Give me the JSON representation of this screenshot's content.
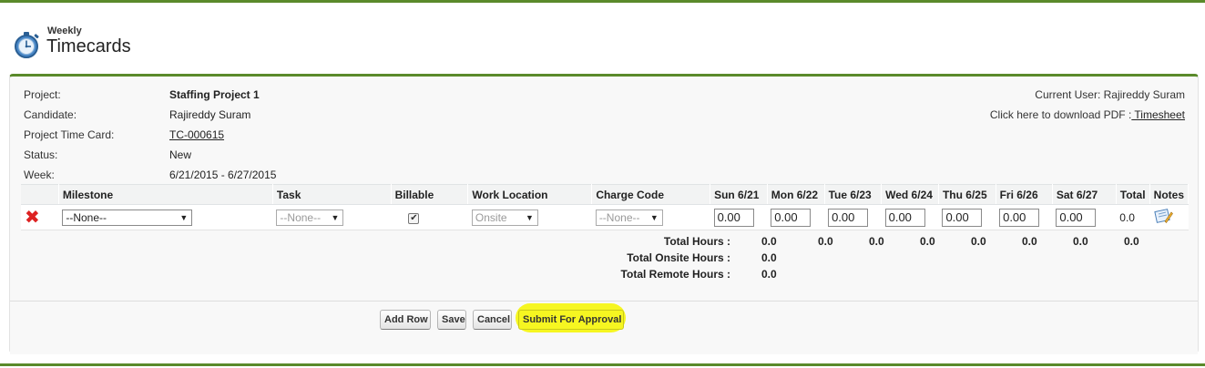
{
  "header": {
    "small": "Weekly",
    "title": "Timecards",
    "icon": "stopwatch-icon"
  },
  "info": {
    "project_label": "Project:",
    "project_value": "Staffing Project 1",
    "candidate_label": "Candidate:",
    "candidate_value": "Rajireddy Suram",
    "ptc_label": "Project Time Card:",
    "ptc_value": "TC-000615",
    "status_label": "Status:",
    "status_value": "New",
    "week_label": "Week:",
    "week_value": "6/21/2015 - 6/27/2015"
  },
  "right": {
    "current_user": "Current User: Rajireddy Suram",
    "pdf_text": "Click here to download PDF :",
    "pdf_link": " Timesheet"
  },
  "table": {
    "headers": [
      "Milestone",
      "Task",
      "Billable",
      "Work Location",
      "Charge Code",
      "Sun 6/21",
      "Mon 6/22",
      "Tue 6/23",
      "Wed 6/24",
      "Thu 6/25",
      "Fri 6/26",
      "Sat 6/27",
      "Total",
      "Notes"
    ],
    "row": {
      "milestone": "--None--",
      "task": "--None--",
      "billable": true,
      "work_location": "Onsite",
      "charge_code": "--None--",
      "days": [
        "0.00",
        "0.00",
        "0.00",
        "0.00",
        "0.00",
        "0.00",
        "0.00"
      ],
      "total": "0.0"
    }
  },
  "totals": {
    "hours_label": "Total Hours :",
    "hours_values": [
      "0.0",
      "0.0",
      "0.0",
      "0.0",
      "0.0",
      "0.0",
      "0.0",
      "0.0"
    ],
    "onsite_label": "Total Onsite Hours :",
    "onsite_value": "0.0",
    "remote_label": "Total Remote Hours :",
    "remote_value": "0.0"
  },
  "buttons": {
    "add_row": "Add Row",
    "save": "Save",
    "cancel": "Cancel",
    "submit": "Submit For Approval"
  },
  "colors": {
    "accent_green": "#5a8a2a",
    "highlight": "#f6f621",
    "delete_red": "#d22222"
  }
}
